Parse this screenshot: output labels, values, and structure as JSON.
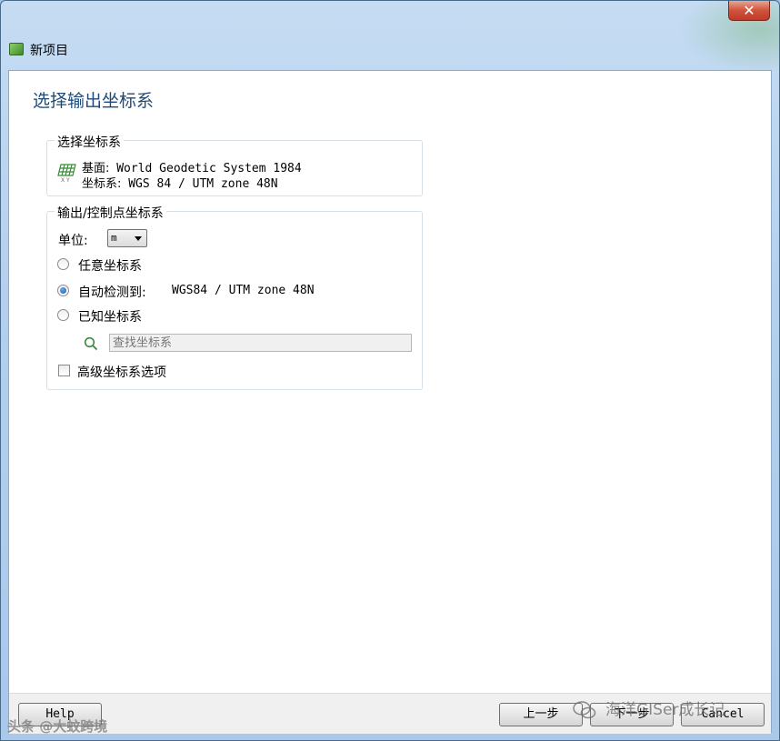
{
  "window": {
    "title": "新项目",
    "close_label": "✕"
  },
  "page": {
    "title": "选择输出坐标系"
  },
  "select_group": {
    "legend": "选择坐标系",
    "datum_label": "基面:",
    "datum_value": "World Geodetic System 1984",
    "cs_label": "坐标系:",
    "cs_value": "WGS 84 / UTM zone 48N",
    "icon": "grid-xy-icon"
  },
  "output_group": {
    "legend": "输出/控制点坐标系",
    "unit_label": "单位:",
    "unit_value": "m",
    "options": [
      {
        "label": "任意坐标系",
        "checked": false
      },
      {
        "label": "自动检测到:",
        "checked": true,
        "value": "WGS84 / UTM zone 48N"
      },
      {
        "label": "已知坐标系",
        "checked": false
      }
    ],
    "search_placeholder": "查找坐标系",
    "advanced_label": "高级坐标系选项",
    "advanced_checked": false
  },
  "footer": {
    "help_label": "Help",
    "back_label": "上一步",
    "next_label": "下一步",
    "cancel_label": "Cancel"
  },
  "watermarks": {
    "left": "头条 @大蚊跨境",
    "right": "海洋GISer成长记"
  }
}
